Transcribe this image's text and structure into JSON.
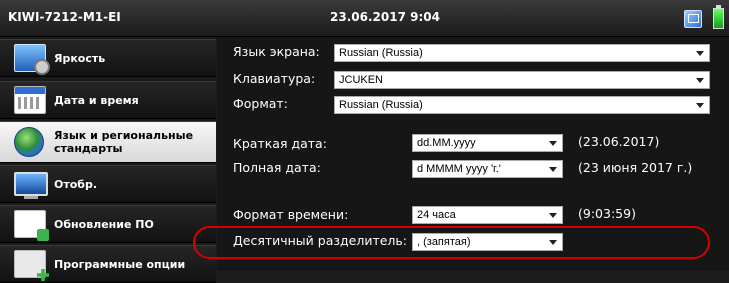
{
  "titlebar": {
    "device": "KIWI-7212-M1-EI",
    "datetime": "23.06.2017 9:04",
    "icons": [
      "window-icon",
      "battery-icon"
    ]
  },
  "sidebar": {
    "items": [
      {
        "label": "Яркость",
        "icon": "brightness-icon"
      },
      {
        "label": "Дата и время",
        "icon": "calendar-icon"
      },
      {
        "label": "Язык и региональные стандарты",
        "icon": "globe-icon",
        "active": true
      },
      {
        "label": "Отобр.",
        "icon": "display-icon"
      },
      {
        "label": "Обновление ПО",
        "icon": "software-update-icon"
      },
      {
        "label": "Программные опции",
        "icon": "software-options-icon"
      }
    ]
  },
  "settings": {
    "display_language": {
      "label": "Язык экрана:",
      "value": "Russian (Russia)"
    },
    "keyboard": {
      "label": "Клавиатура:",
      "value": "JCUKEN"
    },
    "format": {
      "label": "Формат:",
      "value": "Russian (Russia)"
    },
    "short_date": {
      "label": "Краткая дата:",
      "value": "dd.MM.yyyy",
      "preview": "(23.06.2017)"
    },
    "long_date": {
      "label": "Полная дата:",
      "value": "d MMMM yyyy 'г.'",
      "preview": "(23 июня 2017 г.)"
    },
    "time_format": {
      "label": "Формат времени:",
      "value": "24 часа",
      "preview": "(9:03:59)"
    },
    "decimal_separator": {
      "label": "Десятичный разделитель:",
      "value": ", (запятая)"
    }
  },
  "colors": {
    "highlight": "#d60000",
    "active_item_bg": "#eeeeee"
  }
}
